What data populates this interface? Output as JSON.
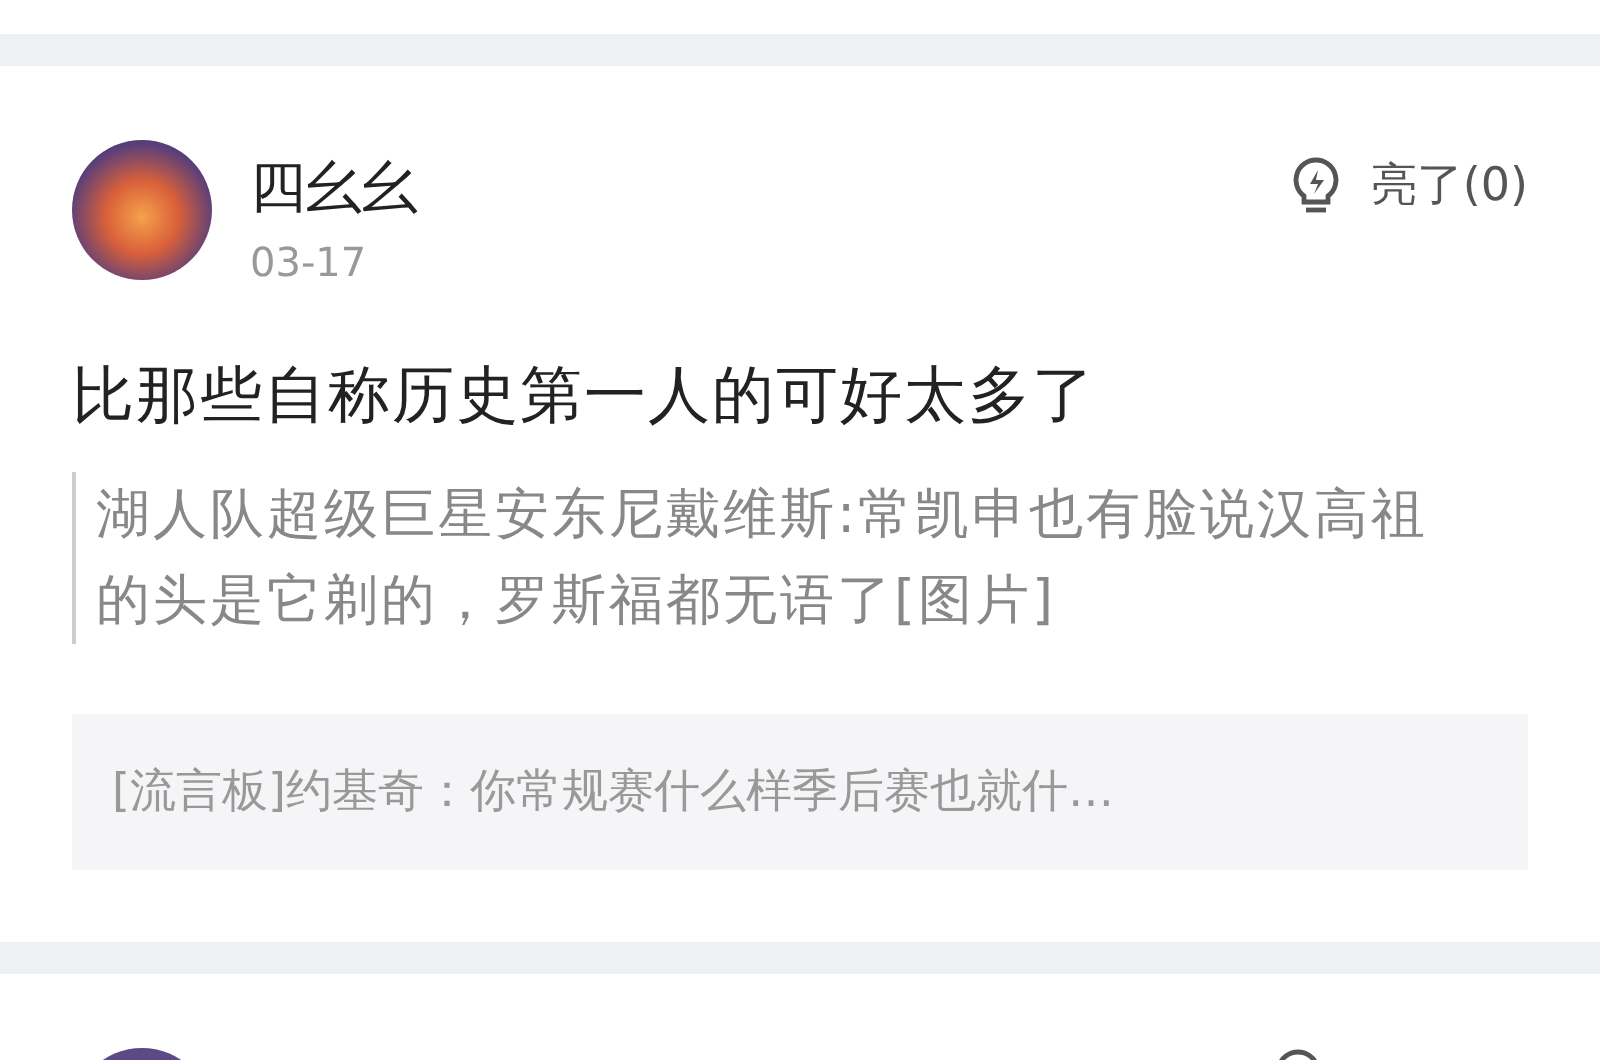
{
  "posts": [
    {
      "author": "四幺幺",
      "date": "03-17",
      "like_label": "亮了(0)",
      "text": "比那些自称历史第一人的可好太多了",
      "quote": "湖人队超级巨星安东尼戴维斯:常凯申也有脸说汉高祖的头是它剃的，罗斯福都无语了[图片]",
      "reference": "[流言板]约基奇：你常规赛什么样季后赛也就什…"
    }
  ]
}
